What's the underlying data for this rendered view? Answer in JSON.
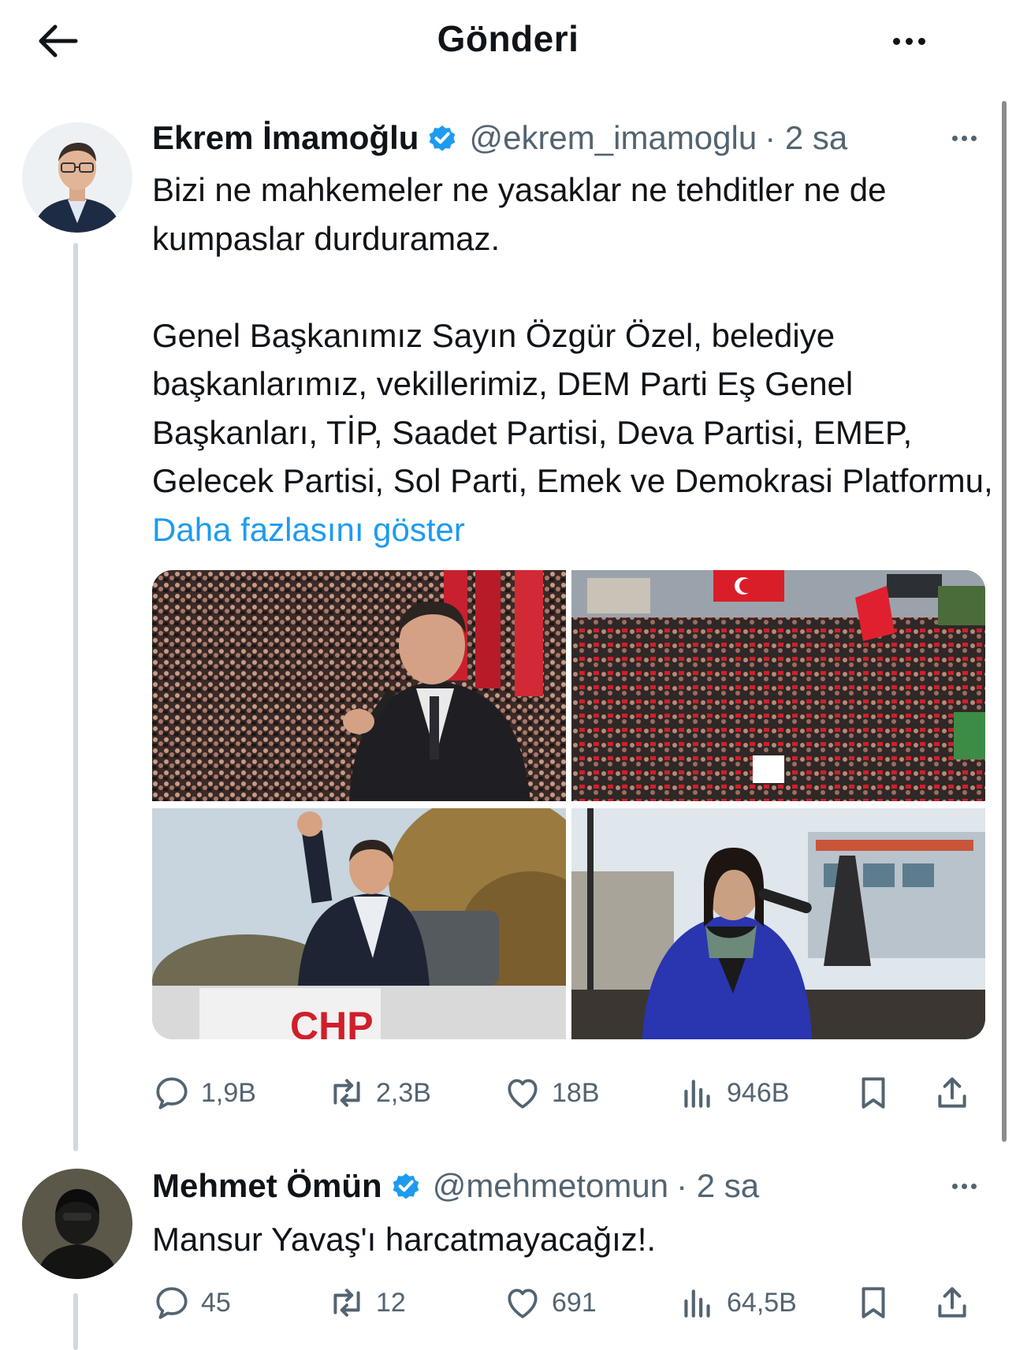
{
  "header": {
    "title": "Gönderi",
    "back_icon": "arrow-left-icon",
    "more_icon": "more-horizontal-icon"
  },
  "colors": {
    "link": "#1d9bf0",
    "verified": "#1d9bf0",
    "muted": "#536471",
    "text": "#0f1419",
    "thread_line": "#cfd9de"
  },
  "main_tweet": {
    "name": "Ekrem İmamoğlu",
    "handle": "@ekrem_imamoglu",
    "time": "· 2 sa",
    "verified": true,
    "text_paragraph_1": "Bizi ne mahkemeler ne yasaklar ne tehditler ne de kumpaslar durduramaz.",
    "text_paragraph_2": "Genel Başkanımız Sayın Özgür Özel, belediye başkanlarımız, vekillerimiz, DEM Parti Eş Genel Başkanları, TİP, Saadet Partisi, Deva Partisi, EMEP, Gelecek Partisi, Sol Parti, Emek ve Demokrasi Platformu, ",
    "show_more": "Daha fazlasını göster",
    "media": [
      {
        "icon": "photo-speaker-crowd-icon"
      },
      {
        "icon": "photo-crowd-flags-icon"
      },
      {
        "icon": "photo-raised-fist-icon"
      },
      {
        "icon": "photo-woman-speaker-icon"
      }
    ],
    "actions": {
      "replies": "1,9B",
      "reposts": "2,3B",
      "likes": "18B",
      "views": "946B"
    }
  },
  "reply_tweet": {
    "name": "Mehmet Ömün",
    "handle": "@mehmetomun",
    "time": "· 2 sa",
    "verified": true,
    "text": "Mansur Yavaş'ı harcatmayacağız!.",
    "actions": {
      "replies": "45",
      "reposts": "12",
      "likes": "691",
      "views": "64,5B"
    }
  }
}
